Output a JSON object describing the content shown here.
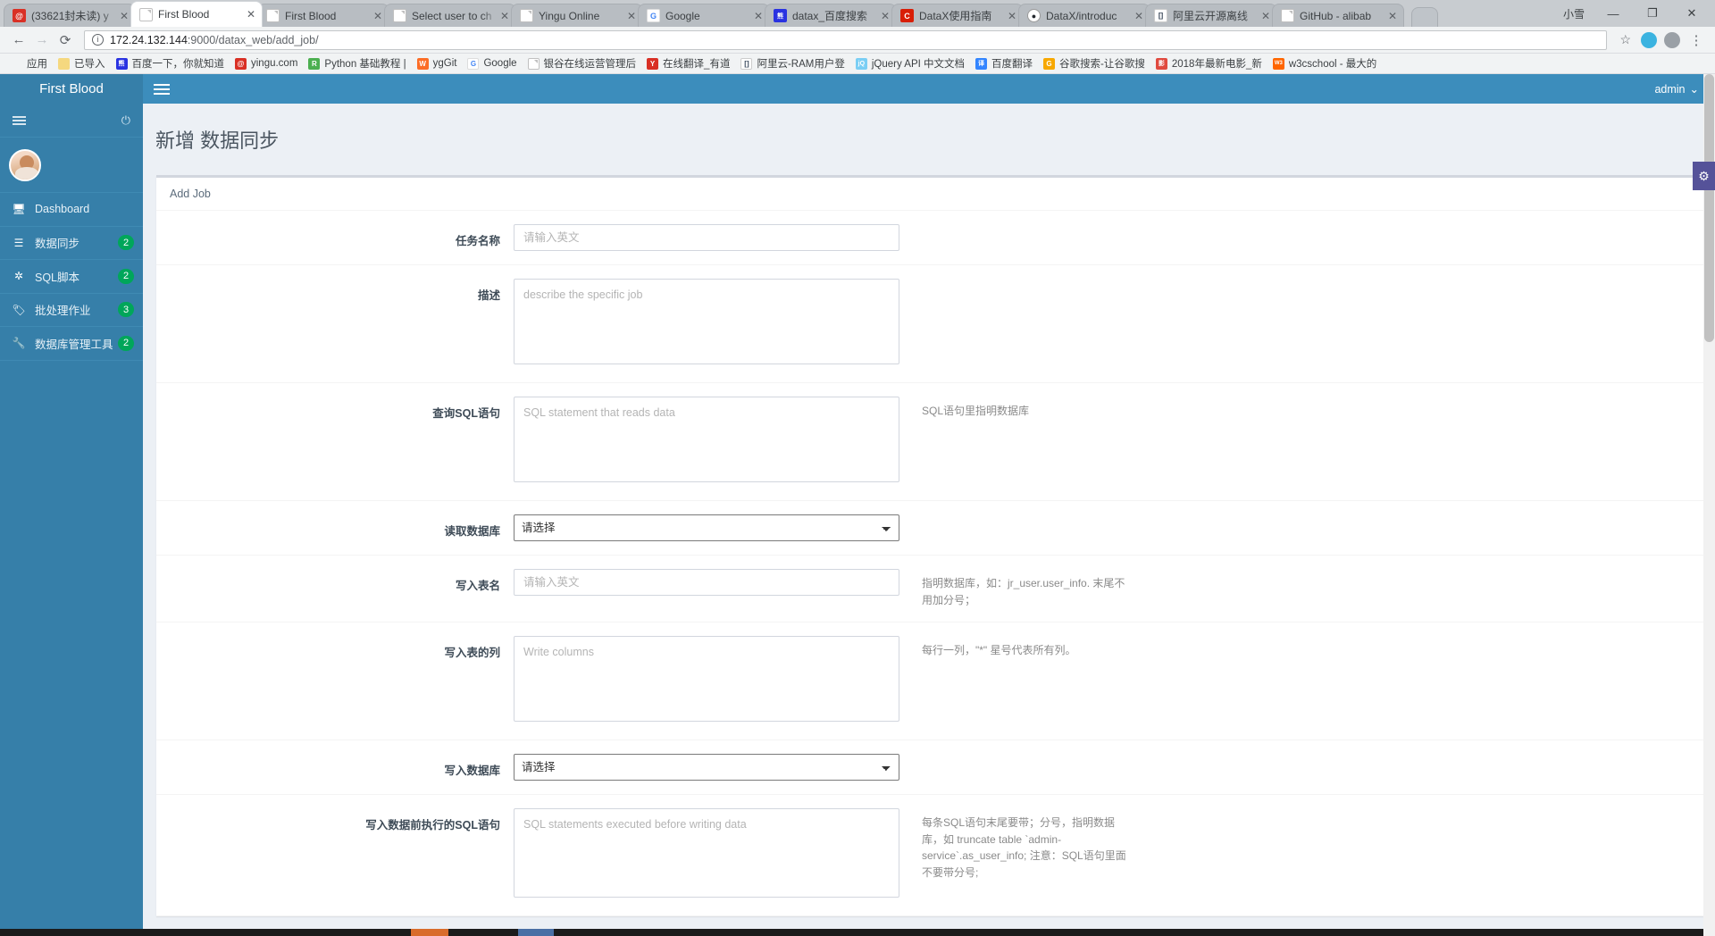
{
  "browser": {
    "tabs": [
      {
        "title": "(33621封未读) y",
        "favicon": "mail-icon",
        "color": "#d93025",
        "glyph": "@",
        "active": false
      },
      {
        "title": "First Blood",
        "favicon": "doc-icon",
        "active": true
      },
      {
        "title": "First Blood",
        "favicon": "doc-icon",
        "active": false
      },
      {
        "title": "Select user to ch",
        "favicon": "doc-icon",
        "active": false
      },
      {
        "title": "Yingu Online",
        "favicon": "doc-icon",
        "active": false
      },
      {
        "title": "Google",
        "favicon": "google-icon",
        "color": "#ffffff",
        "glyph": "G",
        "active": false
      },
      {
        "title": "datax_百度搜索",
        "favicon": "baidu-icon",
        "color": "#2932e1",
        "glyph": "熊",
        "active": false
      },
      {
        "title": "DataX使用指南",
        "favicon": "csdn-icon",
        "color": "#d81e06",
        "glyph": "C",
        "active": false
      },
      {
        "title": "DataX/introduc",
        "favicon": "github-icon",
        "color": "#24292e",
        "glyph": "O",
        "active": false
      },
      {
        "title": "阿里云开源离线",
        "favicon": "aliyun-icon",
        "color": "#2d3b4e",
        "glyph": "[ ]",
        "active": false
      },
      {
        "title": "GitHub - alibab",
        "favicon": "doc-icon",
        "active": false
      }
    ],
    "window_label": "小雪",
    "window_controls": {
      "minimize": "—",
      "maximize": "❐",
      "close": "✕"
    },
    "newtab_tooltip": "New Tab",
    "nav": {
      "back": "←",
      "forward": "→",
      "reload": "⟳",
      "info_icon": "i",
      "url_host": "172.24.132.144",
      "url_rest": ":9000/datax_web/add_job/",
      "star": "☆"
    },
    "bookmarks": [
      {
        "label": "应用",
        "icon": "apps-grid-icon",
        "color": "grid"
      },
      {
        "label": "已导入",
        "icon": "folder-icon",
        "color": "#f5d87f"
      },
      {
        "label": "百度一下，你就知道",
        "icon": "baidu-icon",
        "color": "#2932e1",
        "glyph": "熊"
      },
      {
        "label": "yingu.com",
        "icon": "mail-icon",
        "color": "#d93025",
        "glyph": "@"
      },
      {
        "label": "Python 基础教程 |",
        "icon": "runoob-icon",
        "color": "#4caf50",
        "glyph": "R"
      },
      {
        "label": "ygGit",
        "icon": "gitlab-icon",
        "color": "#fc6d26",
        "glyph": "W"
      },
      {
        "label": "Google",
        "icon": "google-icon",
        "color": "#ffffff",
        "glyph": "G"
      },
      {
        "label": "银谷在线运营管理后",
        "icon": "doc-icon",
        "color": "#ffffff",
        "glyph": ""
      },
      {
        "label": "在线翻译_有道",
        "icon": "youdao-icon",
        "color": "#d93025",
        "glyph": "Y"
      },
      {
        "label": "阿里云-RAM用户登",
        "icon": "aliyun-icon",
        "color": "#3b4a5e",
        "glyph": "[]"
      },
      {
        "label": "jQuery API 中文文档",
        "icon": "jquery-icon",
        "color": "#7acef4",
        "glyph": "jQ"
      },
      {
        "label": "百度翻译",
        "icon": "baidu-fanyi-icon",
        "color": "#3385ff",
        "glyph": "译"
      },
      {
        "label": "谷歌搜索-让谷歌搜",
        "icon": "google-icon",
        "color": "#f7a800",
        "glyph": "G"
      },
      {
        "label": "2018年最新电影_新",
        "icon": "movie-icon",
        "color": "#e04a3f",
        "glyph": "影"
      },
      {
        "label": "w3cschool - 最大的",
        "icon": "w3c-icon",
        "color": "#ff6600",
        "glyph": "W3"
      }
    ]
  },
  "app": {
    "brand": "First Blood",
    "hamburger": "menu-icon",
    "user": "admin",
    "user_caret": "⌄",
    "sidebar": {
      "toggle_icon": "collapse-menu-icon",
      "power_icon": "⏻",
      "avatar": "user-avatar",
      "items": [
        {
          "label": "Dashboard",
          "icon": "🖥",
          "icon_name": "monitor-icon",
          "badge": ""
        },
        {
          "label": "数据同步",
          "icon": "☰",
          "icon_name": "sync-list-icon",
          "badge": "2"
        },
        {
          "label": "SQL脚本",
          "icon": "✸",
          "icon_name": "asterisk-icon",
          "badge": "2"
        },
        {
          "label": "批处理作业",
          "icon": "🏷",
          "icon_name": "tag-icon",
          "badge": "3"
        },
        {
          "label": "数据库管理工具",
          "icon": "🔧",
          "icon_name": "wrench-icon",
          "badge": "2"
        }
      ]
    },
    "page_title": "新增 数据同步",
    "panel_header": "Add Job",
    "form": [
      {
        "label": "任务名称",
        "type": "input",
        "placeholder": "请输入英文",
        "value": "",
        "hint": ""
      },
      {
        "label": "描述",
        "type": "textarea",
        "placeholder": "describe the specific job",
        "value": "",
        "hint": "",
        "rows": "large"
      },
      {
        "label": "查询SQL语句",
        "type": "textarea",
        "placeholder": "SQL statement that reads data",
        "value": "",
        "hint": "SQL语句里指明数据库",
        "rows": "large"
      },
      {
        "label": "读取数据库",
        "type": "select",
        "value": "请选择",
        "options": [
          "请选择"
        ],
        "hint": ""
      },
      {
        "label": "写入表名",
        "type": "input",
        "placeholder": "请输入英文",
        "value": "",
        "hint": "指明数据库，如：jr_user.user_info. 末尾不用加分号；"
      },
      {
        "label": "写入表的列",
        "type": "textarea",
        "placeholder": "Write columns",
        "value": "",
        "hint": "每行一列，\"*\" 星号代表所有列。",
        "rows": "large"
      },
      {
        "label": "写入数据库",
        "type": "select",
        "value": "请选择",
        "options": [
          "请选择"
        ],
        "hint": ""
      },
      {
        "label": "写入数据前执行的SQL语句",
        "type": "textarea",
        "placeholder": "SQL statements executed before writing data",
        "value": "",
        "hint": "每条SQL语句末尾要带；分号，指明数据库，如 truncate table `admin-service`.as_user_info; 注意：SQL语句里面不要带分号;",
        "rows": "large"
      }
    ],
    "gear_icon": "settings-gear-icon"
  }
}
